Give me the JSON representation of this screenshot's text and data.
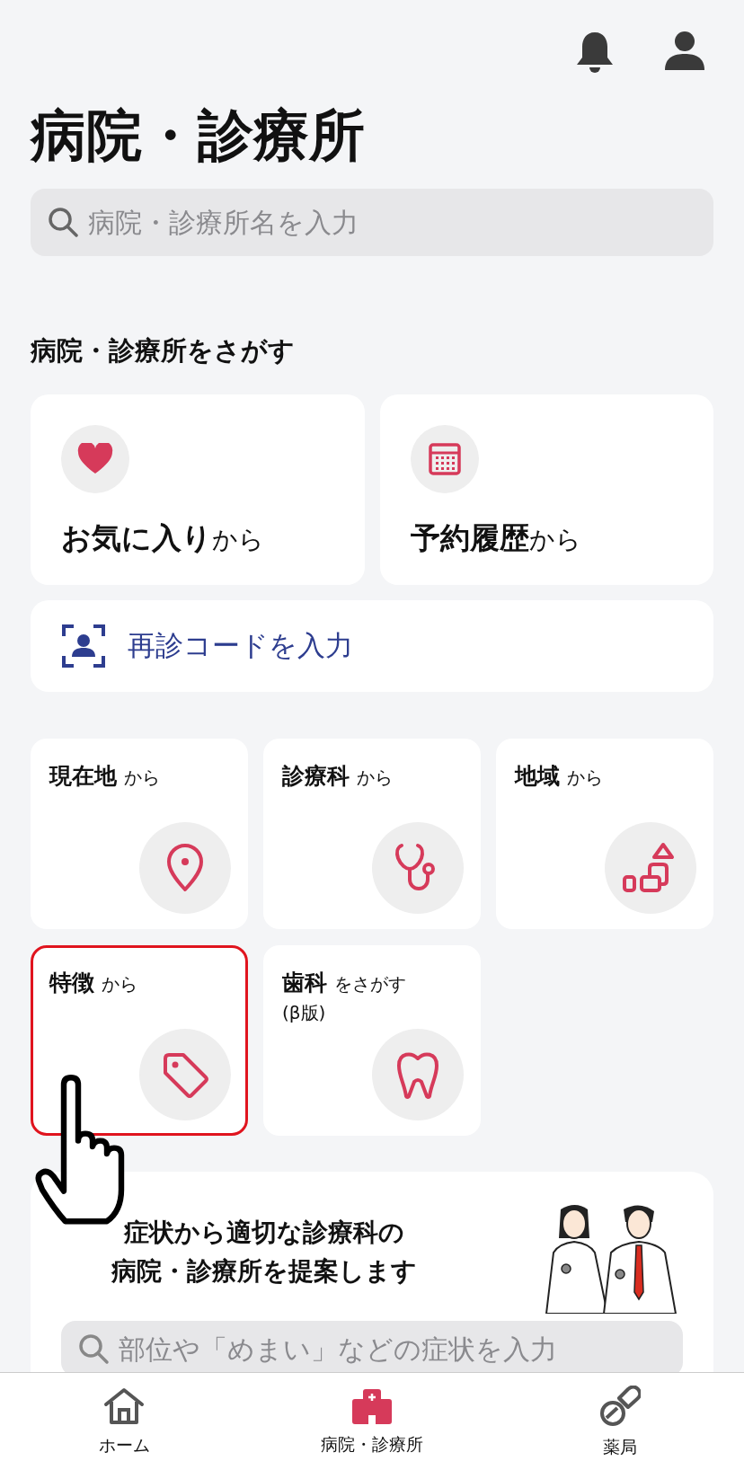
{
  "title": "病院・診療所",
  "search": {
    "placeholder": "病院・診療所名を入力"
  },
  "section_title": "病院・診療所をさがす",
  "quick_cards": [
    {
      "bold": "お気に入り",
      "suffix": "から"
    },
    {
      "bold": "予約履歴",
      "suffix": "から"
    }
  ],
  "revisit_code": {
    "label": "再診コードを入力"
  },
  "search_tiles": [
    {
      "bold": "現在地",
      "suffix": "から",
      "highlighted": false
    },
    {
      "bold": "診療科",
      "suffix": "から",
      "highlighted": false
    },
    {
      "bold": "地域",
      "suffix": "から",
      "highlighted": false
    },
    {
      "bold": "特徴",
      "suffix": "から",
      "highlighted": true
    },
    {
      "bold": "歯科",
      "suffix": "をさがす",
      "note": "(β版)",
      "highlighted": false
    }
  ],
  "symptom_search": {
    "heading_lines": [
      "症状から適切な診療科の",
      "病院・診療所を提案します"
    ],
    "placeholder": "部位や「めまい」などの症状を入力"
  },
  "nav": [
    {
      "label": "ホーム",
      "selected": false
    },
    {
      "label": "病院・診療所",
      "selected": true
    },
    {
      "label": "薬局",
      "selected": false
    }
  ]
}
